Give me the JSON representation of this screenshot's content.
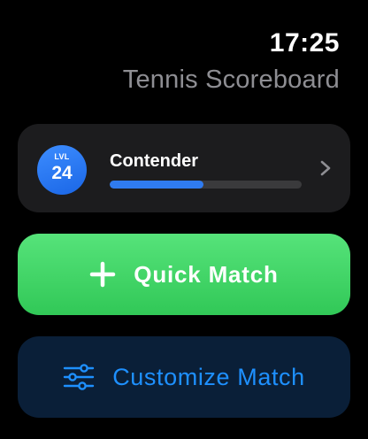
{
  "status": {
    "time": "17:25"
  },
  "app": {
    "title": "Tennis Scoreboard"
  },
  "level_card": {
    "level_label": "LVL",
    "level_number": "24",
    "rank_name": "Contender",
    "progress_fraction": 0.49
  },
  "actions": {
    "quick_match_label": "Quick Match",
    "customize_match_label": "Customize Match"
  },
  "colors": {
    "background": "#000000",
    "card": "#1c1c1e",
    "accent_blue": "#1e90ff",
    "badge_blue": "#2f7bf0",
    "quick_green": "#3ed264",
    "customize_bg": "#0a1f38",
    "title_gray": "#8e8e93"
  },
  "icons": {
    "quick_match": "plus-icon",
    "customize_match": "sliders-icon",
    "level_card": "chevron-right-icon"
  }
}
